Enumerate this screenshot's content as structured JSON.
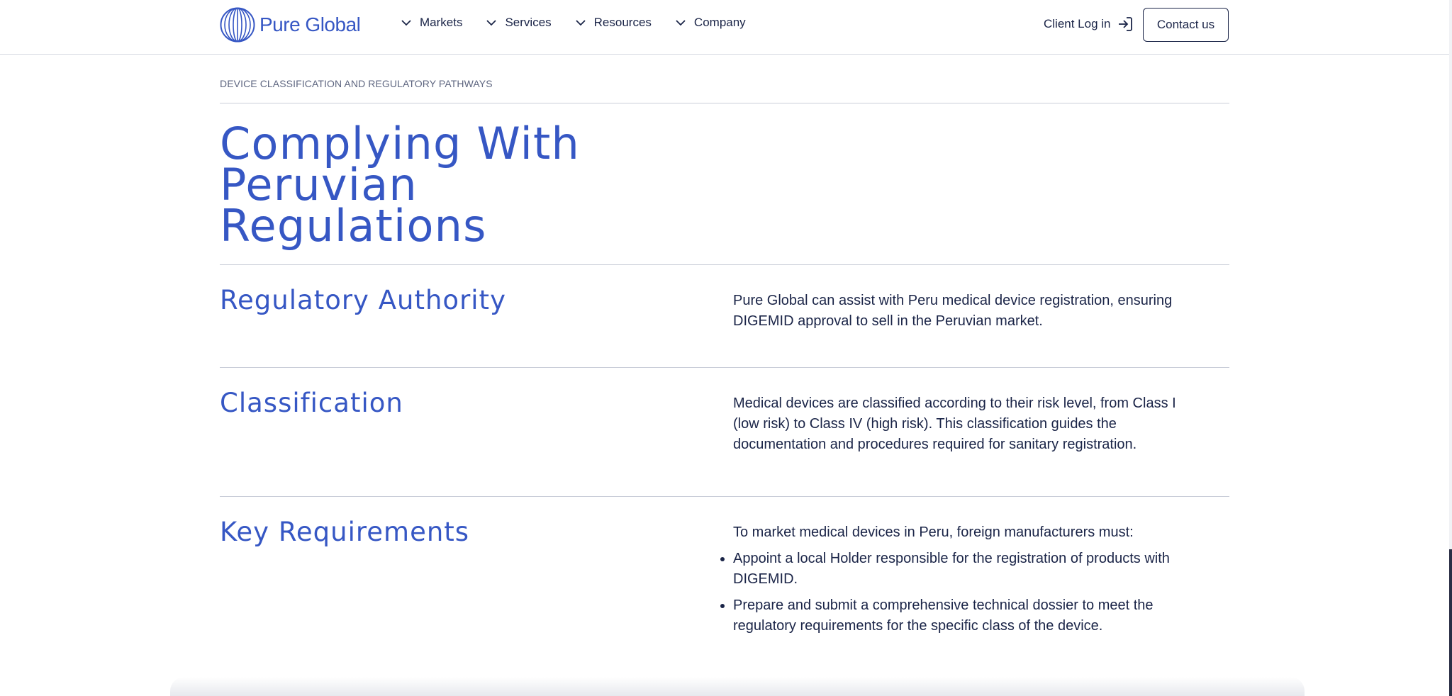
{
  "header": {
    "logo_text": "Pure Global",
    "nav": [
      {
        "label": "Markets"
      },
      {
        "label": "Services"
      },
      {
        "label": "Resources"
      },
      {
        "label": "Company"
      }
    ],
    "client_login_label": "Client Log in",
    "contact_label": "Contact us"
  },
  "main": {
    "eyebrow": "DEVICE CLASSIFICATION AND REGULATORY PATHWAYS",
    "title_line1": "Complying With Peruvian",
    "title_line2": "Regulations",
    "sections": [
      {
        "heading": "Regulatory Authority",
        "body": "Pure Global can assist with Peru medical device registration, ensuring DIGEMID approval to sell in the Peruvian market."
      },
      {
        "heading": "Classification",
        "body": "Medical devices are classified according to their risk level, from Class I (low risk) to Class IV (high risk). This classification guides the documentation and procedures required for sanitary registration."
      },
      {
        "heading": "Key Requirements",
        "intro": "To market medical devices in Peru, foreign manufacturers must:",
        "bullets": [
          "Appoint a local Holder responsible for the registration of products with DIGEMID.",
          "Prepare and submit a comprehensive technical dossier to meet the regulatory requirements for the specific class of the device."
        ]
      }
    ]
  },
  "colors": {
    "brand_blue": "#3657c4",
    "text_dark": "#1a2447"
  },
  "icons": {
    "logo": "globe-lines-icon",
    "nav_chevron": "chevron-down-icon",
    "login": "sign-in-arrow-icon"
  }
}
